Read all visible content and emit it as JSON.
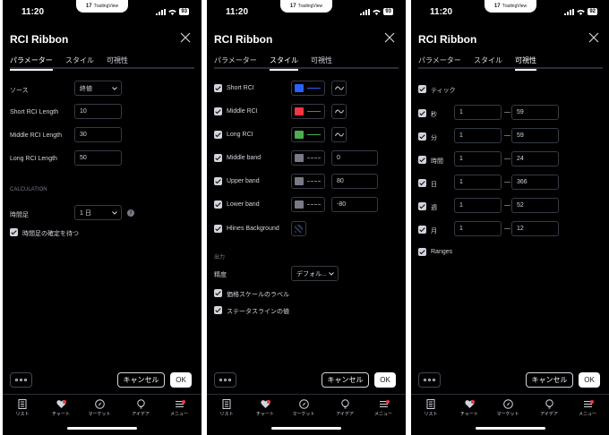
{
  "status": {
    "time": "11:20",
    "brand": "TradingView",
    "battery1": "93",
    "battery2": "93",
    "battery3": "92"
  },
  "dialog": {
    "title": "RCI Ribbon"
  },
  "tabs": [
    "パラメーター",
    "スタイル",
    "可視性"
  ],
  "params": {
    "source_label": "ソース",
    "source_value": "終値",
    "short_label": "Short RCI Length",
    "short_value": "10",
    "middle_label": "Middle RCI Length",
    "middle_value": "30",
    "long_label": "Long RCI Length",
    "long_value": "50",
    "section": "CALCULATION",
    "timeframe_label": "時間足",
    "timeframe_value": "1 日",
    "wait_label": "時間足の確定を待つ"
  },
  "style": {
    "rows": [
      {
        "label": "Short RCI",
        "color": "#2962ff"
      },
      {
        "label": "Middle RCI",
        "color": "#f23645"
      },
      {
        "label": "Long RCI",
        "color": "#4caf50"
      }
    ],
    "bands": [
      {
        "label": "Middle band",
        "value": "0"
      },
      {
        "label": "Upper band",
        "value": "80"
      },
      {
        "label": "Lower band",
        "value": "-80"
      }
    ],
    "hlines_label": "Hlines Background",
    "output_section": "出力",
    "precision_label": "精度",
    "precision_value": "デフォル...",
    "scale_label": "価格スケールのラベル",
    "statusline_label": "ステータスラインの値"
  },
  "visibility": {
    "tick_label": "ティック",
    "rows": [
      {
        "label": "秒",
        "from": "1",
        "to": "59"
      },
      {
        "label": "分",
        "from": "1",
        "to": "59"
      },
      {
        "label": "時間",
        "from": "1",
        "to": "24"
      },
      {
        "label": "日",
        "from": "1",
        "to": "366"
      },
      {
        "label": "週",
        "from": "1",
        "to": "52"
      },
      {
        "label": "月",
        "from": "1",
        "to": "12"
      }
    ],
    "ranges_label": "Ranges",
    "dash": "—"
  },
  "footer": {
    "cancel": "キャンセル",
    "ok": "OK"
  },
  "nav": [
    "リスト",
    "チャート",
    "マーケット",
    "アイデア",
    "メニュー"
  ]
}
